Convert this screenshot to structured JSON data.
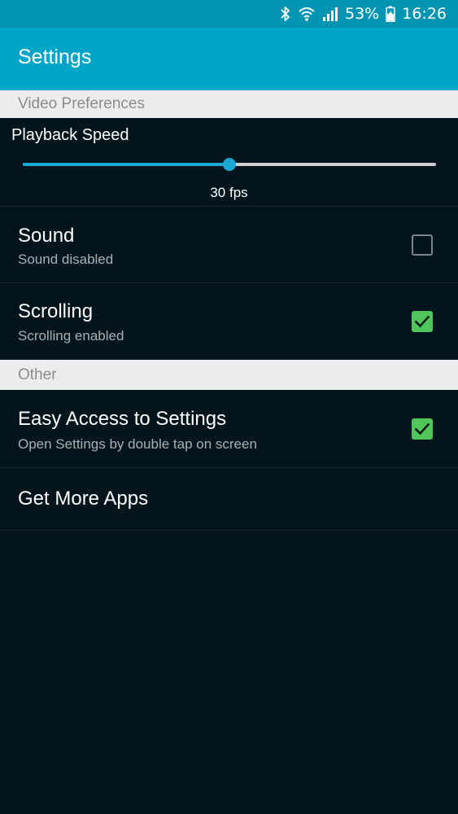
{
  "status_bar": {
    "battery": "53%",
    "time": "16:26",
    "icons": [
      "bluetooth-icon",
      "wifi-icon",
      "signal-icon",
      "battery-charging-icon"
    ]
  },
  "app_bar": {
    "title": "Settings"
  },
  "video_section": {
    "header": "Video Preferences",
    "playback_speed": {
      "label": "Playback Speed",
      "value_text": "30 fps",
      "position_fraction": 0.5
    },
    "sound": {
      "title": "Sound",
      "summary": "Sound disabled",
      "checked": false
    },
    "scrolling": {
      "title": "Scrolling",
      "summary": "Scrolling enabled",
      "checked": true
    }
  },
  "other_section": {
    "header": "Other",
    "easy_access": {
      "title": "Easy Access to Settings",
      "summary": "Open Settings by double tap on screen",
      "checked": true
    },
    "get_more_apps": {
      "title": "Get More Apps"
    }
  },
  "colors": {
    "accent": "#1aa7d4",
    "app_bar": "#00a6c8",
    "status_bar": "#0094b3",
    "checkbox_on": "#4fc55a",
    "background": "#02141c",
    "section_header": "#ececec"
  }
}
